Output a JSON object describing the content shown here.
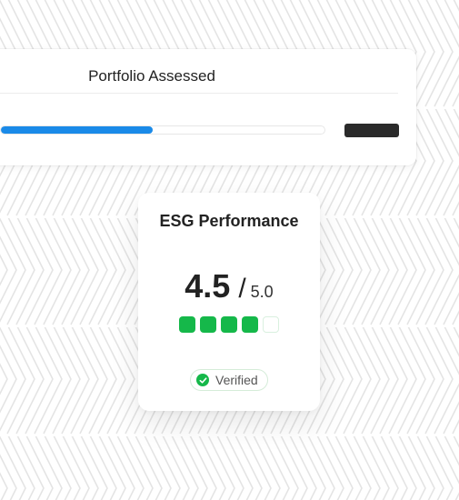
{
  "portfolio": {
    "title": "Portfolio Assessed",
    "progress_fraction": 0.47
  },
  "esg": {
    "title": "ESG Performance",
    "score": "4.5",
    "separator": "/",
    "max": "5.0",
    "rating": {
      "filled": 4,
      "total": 5
    },
    "badge": {
      "label": "Verified",
      "icon": "check-circle-icon"
    }
  },
  "colors": {
    "accent_blue": "#1a8ae8",
    "rating_green": "#15b84a",
    "text_dark": "#222222",
    "pill_dark": "#2a2a2a"
  }
}
